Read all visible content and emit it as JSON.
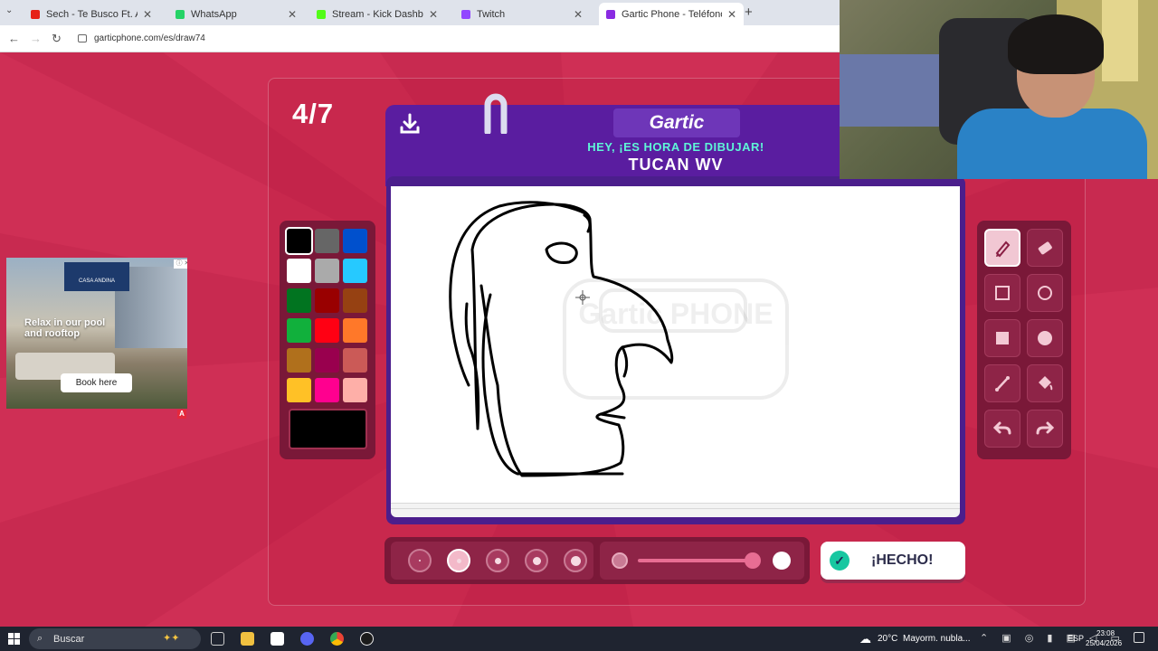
{
  "browser": {
    "tabs": [
      {
        "title": "Sech - Te Busco Ft. Alex Ro",
        "favicon_color": "#e62117",
        "active": false
      },
      {
        "title": "WhatsApp",
        "favicon_color": "#25d366",
        "active": false
      },
      {
        "title": "Stream - Kick Dashboard",
        "favicon_color": "#53fc18",
        "active": false
      },
      {
        "title": "Twitch",
        "favicon_color": "#9146ff",
        "active": false
      },
      {
        "title": "Gartic Phone - Teléfono Descor",
        "favicon_color": "#8a2be2",
        "active": true
      }
    ],
    "url": "garticphone.com/es/draw74"
  },
  "game": {
    "round": "4/7",
    "logo": "Gartic",
    "prompt_label": "HEY, ¡ES HORA DE DIBUJAR!",
    "prompt_word": "TUCAN WV",
    "watermark": "Gartic PHONE",
    "done_label": "¡HECHO!",
    "palette": [
      "#000000",
      "#666666",
      "#0050cd",
      "#ffffff",
      "#aaaaaa",
      "#26c9ff",
      "#017420",
      "#990000",
      "#964112",
      "#11b03c",
      "#ff0013",
      "#ff7829",
      "#b0701c",
      "#99004e",
      "#cb5a57",
      "#ffc126",
      "#ff008f",
      "#feafa8"
    ],
    "selected_color": "#000000",
    "tools": [
      "pencil-icon",
      "eraser-icon",
      "rectangle-outline-icon",
      "circle-outline-icon",
      "rectangle-fill-icon",
      "circle-fill-icon",
      "line-icon",
      "bucket-icon",
      "undo-icon",
      "redo-icon"
    ],
    "selected_tool": "pencil-icon",
    "brush_sizes": 5,
    "selected_brush_size": 2,
    "opacity": 0.95
  },
  "ad": {
    "brand": "CASA ANDINA",
    "headline": "Relax in our pool and rooftop",
    "cta": "Book here"
  },
  "taskbar": {
    "search_label": "Buscar",
    "weather_temp": "20°C",
    "weather_desc": "Mayorm. nubla...",
    "lang": "ESP",
    "time": "23:08",
    "date": "25/04/2026"
  }
}
